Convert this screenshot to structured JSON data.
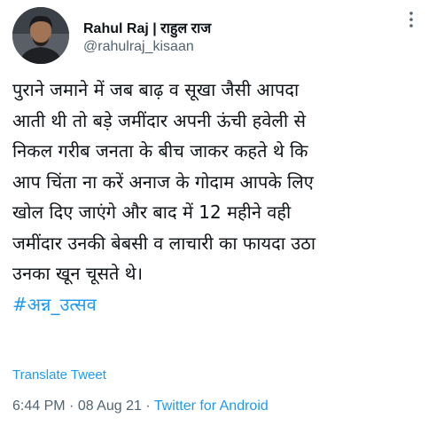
{
  "author": {
    "name": "Rahul Raj | राहुल राज",
    "handle": "@rahulraj_kisaan",
    "avatar_icon": "profile-photo"
  },
  "tweet": {
    "lines": [
      "पुराने जमाने में जब बाढ़ व सूखा जैसी आपदा",
      "आती थी तो बड़े जमींदार अपनी ऊंची हवेली से",
      "निकल गरीब जनता के बीच जाकर कहते थे कि",
      "आप चिंता ना करें अनाज के गोदाम आपके लिए",
      "खोल दिए जाएंगे और बाद में 12 महीने वही",
      "जमींदार उनकी बेबसी व लाचारी का फायदा उठा",
      "उनका खून चूसते थे।"
    ],
    "hashtag": "#अन्न_उत्सव"
  },
  "actions": {
    "translate_label": "Translate Tweet",
    "more_icon": "more-vertical-icon"
  },
  "meta": {
    "time": "6:44 PM",
    "separator1": " · ",
    "date": "08 Aug 21",
    "separator2": " · ",
    "source": "Twitter for Android"
  },
  "colors": {
    "link": "#1d9bf0",
    "secondary_text": "#536471",
    "primary_text": "#0f1419"
  }
}
